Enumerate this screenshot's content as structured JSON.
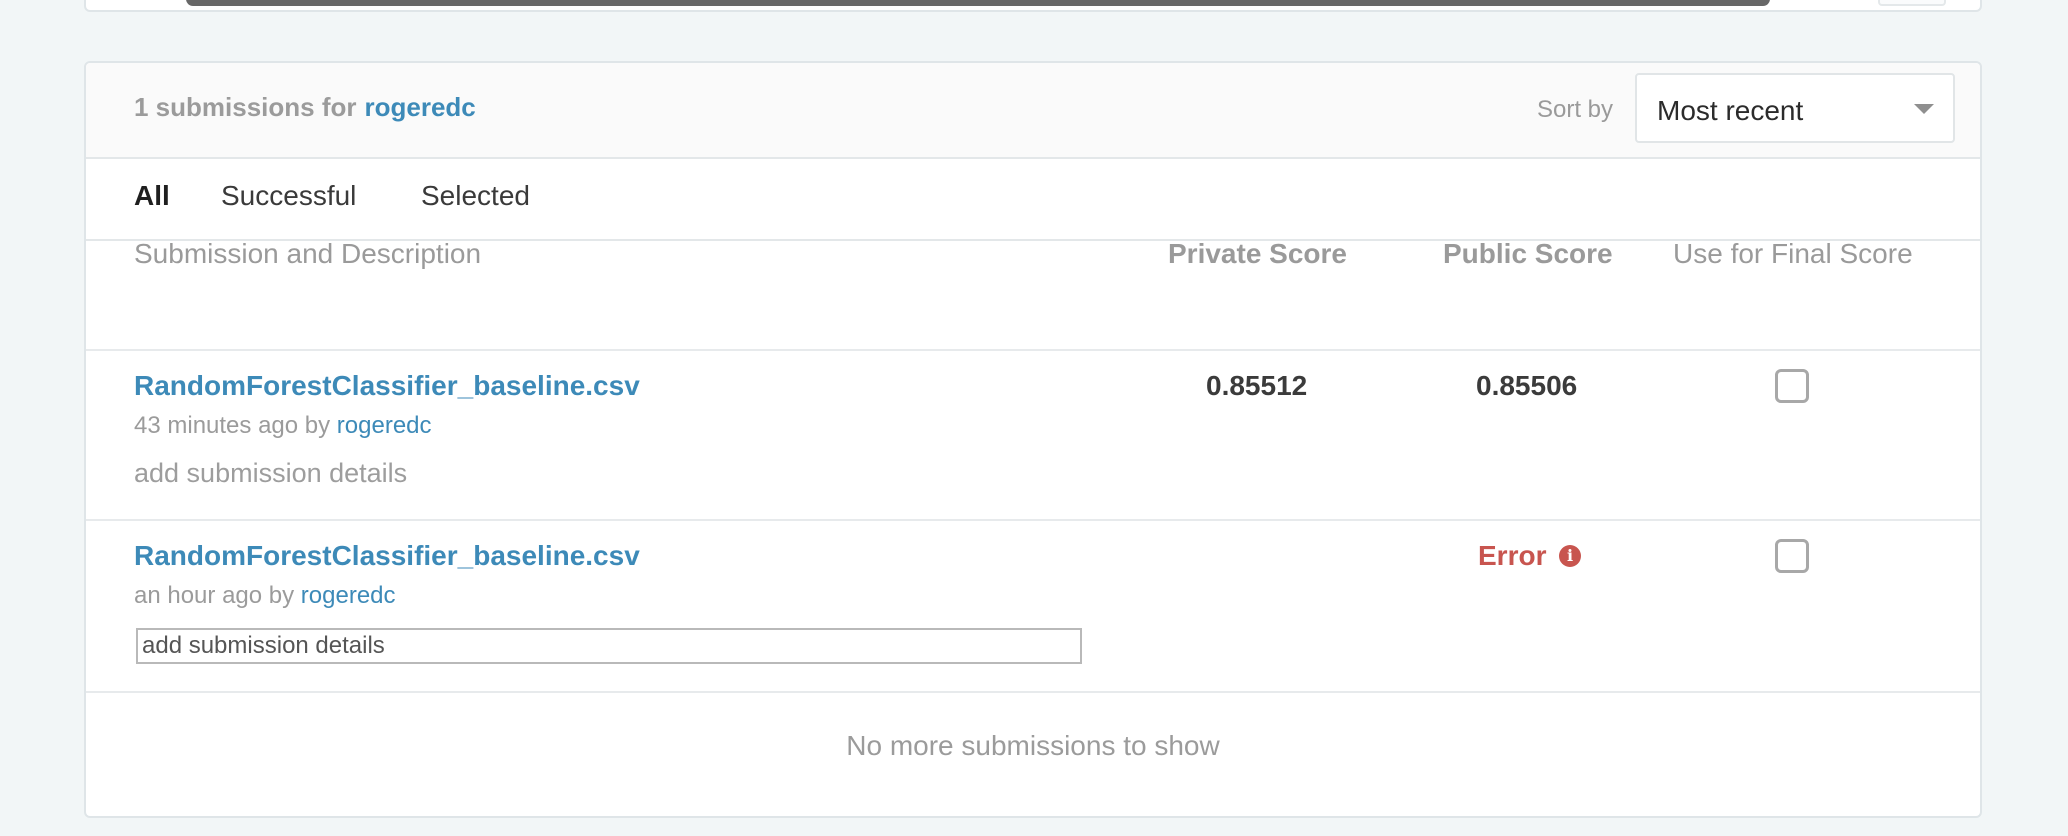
{
  "header": {
    "title_prefix": "1 submissions for",
    "user": "rogeredc",
    "sort_label": "Sort by",
    "sort_value": "Most recent"
  },
  "tabs": [
    {
      "label": "All",
      "active": true
    },
    {
      "label": "Successful",
      "active": false
    },
    {
      "label": "Selected",
      "active": false
    }
  ],
  "columns": {
    "submission": "Submission and Description",
    "private_score": "Private Score",
    "public_score": "Public Score",
    "final_score": "Use for Final Score"
  },
  "submissions": [
    {
      "filename": "RandomForestClassifier_baseline.csv",
      "time": "43 minutes ago by",
      "user": "rogeredc",
      "details": "add submission details",
      "private_score": "0.85512",
      "public_score": "0.85506",
      "selected": false
    },
    {
      "filename": "RandomForestClassifier_baseline.csv",
      "time": "an hour ago by",
      "user": "rogeredc",
      "details_input_value": "add submission details",
      "status": "Error",
      "selected": false
    }
  ],
  "footer": {
    "no_more": "No more submissions to show"
  },
  "icons": {
    "error": "info-circle-icon",
    "sort": "caret-down-icon"
  },
  "colors": {
    "link": "#3d8ab8",
    "error": "#c8554f",
    "background": "#f2f6f7"
  }
}
